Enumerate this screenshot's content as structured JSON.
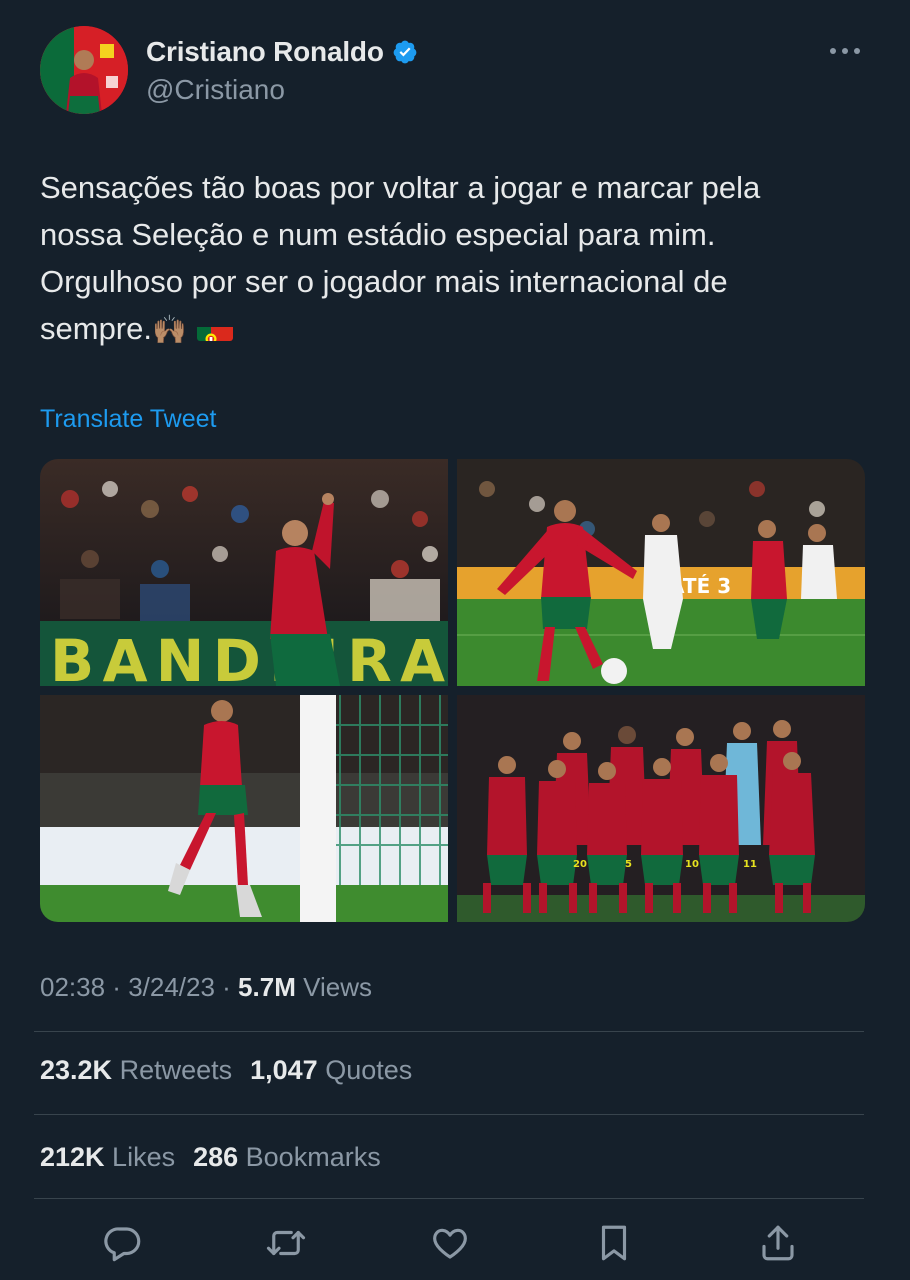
{
  "author": {
    "display_name": "Cristiano Ronaldo",
    "handle": "@Cristiano",
    "verified_icon": "verified-badge-icon"
  },
  "tweet": {
    "text_lines": [
      "Sensações tão boas por voltar a jogar e marcar pela",
      "nossa Seleção e num estádio especial para mim.",
      "Orgulhoso por ser o jogador mais internacional de",
      "sempre."
    ],
    "emoji_hands": "🙌🏽",
    "translate_label": "Translate Tweet"
  },
  "media": [
    {
      "name": "celebration-photo"
    },
    {
      "name": "penalty-kick-photo"
    },
    {
      "name": "running-celebration-photo"
    },
    {
      "name": "team-photo",
      "jersey_numbers": [
        "20",
        "5",
        "10",
        "11"
      ]
    }
  ],
  "advertising_board_text": "BANDEIRA",
  "stadium_board_text": "ATÉ 3",
  "meta": {
    "time": "02:38",
    "sep1": " · ",
    "date": "3/24/23",
    "sep2": " · ",
    "views_count": "5.7M",
    "views_label": " Views"
  },
  "stats": {
    "retweets_count": "23.2K",
    "retweets_label": " Retweets",
    "quotes_count": "1,047",
    "quotes_label": " Quotes",
    "likes_count": "212K",
    "likes_label": " Likes",
    "bookmarks_count": "286",
    "bookmarks_label": " Bookmarks"
  },
  "colors": {
    "background": "#15202b",
    "accent": "#1d9bf0",
    "secondary_text": "#8b98a5",
    "divider": "#38444d"
  },
  "actions": [
    "reply-icon",
    "retweet-icon",
    "like-icon",
    "bookmark-icon",
    "share-icon"
  ]
}
